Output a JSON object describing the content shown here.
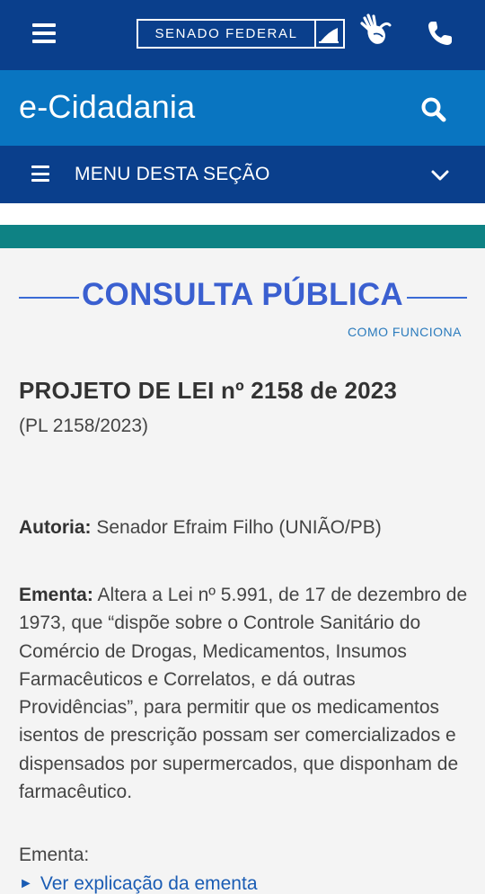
{
  "header": {
    "logo_text": "SENADO FEDERAL",
    "libras_icon": "sign-language-hands-icon",
    "phone_icon": "phone-icon",
    "menu_icon": "hamburger-icon"
  },
  "site": {
    "title": "e-Cidadania",
    "search_icon": "search-icon"
  },
  "section_menu": {
    "label": "MENU DESTA SEÇÃO",
    "toggle_icon": "chevron-down-icon"
  },
  "page": {
    "heading": "CONSULTA PÚBLICA",
    "how_it_works": "COMO FUNCIONA"
  },
  "bill": {
    "title": "PROJETO DE LEI nº 2158 de 2023",
    "short": "(PL 2158/2023)",
    "autoria_label": "Autoria:",
    "autoria_value": "Senador Efraim Filho (UNIÃO/PB)",
    "ementa_label": "Ementa:",
    "ementa_text": "Altera a Lei nº 5.991, de 17 de dezembro de 1973, que “dispõe sobre o Controle Sanitário do Comércio de Drogas, Medicamentos, Insumos Farmacêuticos e Correlatos, e dá outras Providências”, para permitir que os medicamentos isentos de prescrição possam ser comercializados e dispensados por supermercados, que disponham de farmacêutico.",
    "ementa_label_2": "Ementa:",
    "explain_link": "Ver explicação da ementa"
  },
  "colors": {
    "dark_blue": "#0a3f8c",
    "site_blue": "#0975c1",
    "teal": "#0e8284",
    "heading_blue": "#3a5fd0"
  }
}
